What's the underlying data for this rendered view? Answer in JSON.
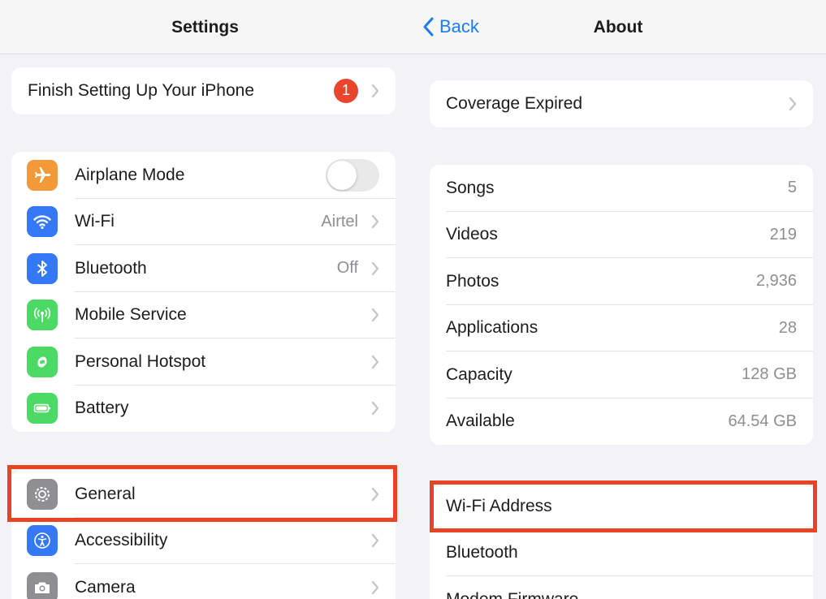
{
  "left": {
    "title": "Settings",
    "setup_row": {
      "label": "Finish Setting Up Your iPhone",
      "badge": "1"
    },
    "connectivity": [
      {
        "label": "Airplane Mode",
        "icon": "airplane-icon",
        "color": "#f19a37",
        "toggle": true
      },
      {
        "label": "Wi-Fi",
        "value": "Airtel",
        "icon": "wifi-icon",
        "color": "#3478f6"
      },
      {
        "label": "Bluetooth",
        "value": "Off",
        "icon": "bluetooth-icon",
        "color": "#3478f6"
      },
      {
        "label": "Mobile Service",
        "icon": "antenna-icon",
        "color": "#4cd964"
      },
      {
        "label": "Personal Hotspot",
        "icon": "hotspot-icon",
        "color": "#4cd964"
      },
      {
        "label": "Battery",
        "icon": "battery-icon",
        "color": "#4cd964"
      }
    ],
    "system": [
      {
        "label": "General",
        "icon": "gear-icon",
        "color": "#8e8e93"
      },
      {
        "label": "Accessibility",
        "icon": "accessibility-icon",
        "color": "#3478f6"
      },
      {
        "label": "Camera",
        "icon": "camera-icon",
        "color": "#8e8e93"
      }
    ]
  },
  "right": {
    "back_label": "Back",
    "title": "About",
    "coverage": {
      "label": "Coverage Expired"
    },
    "stats": [
      {
        "label": "Songs",
        "value": "5"
      },
      {
        "label": "Videos",
        "value": "219"
      },
      {
        "label": "Photos",
        "value": "2,936"
      },
      {
        "label": "Applications",
        "value": "28"
      },
      {
        "label": "Capacity",
        "value": "128 GB"
      },
      {
        "label": "Available",
        "value": "64.54 GB"
      }
    ],
    "network": [
      {
        "label": "Wi-Fi Address"
      },
      {
        "label": "Bluetooth"
      },
      {
        "label": "Modem Firmware"
      }
    ]
  },
  "highlight_color": "#e94323"
}
